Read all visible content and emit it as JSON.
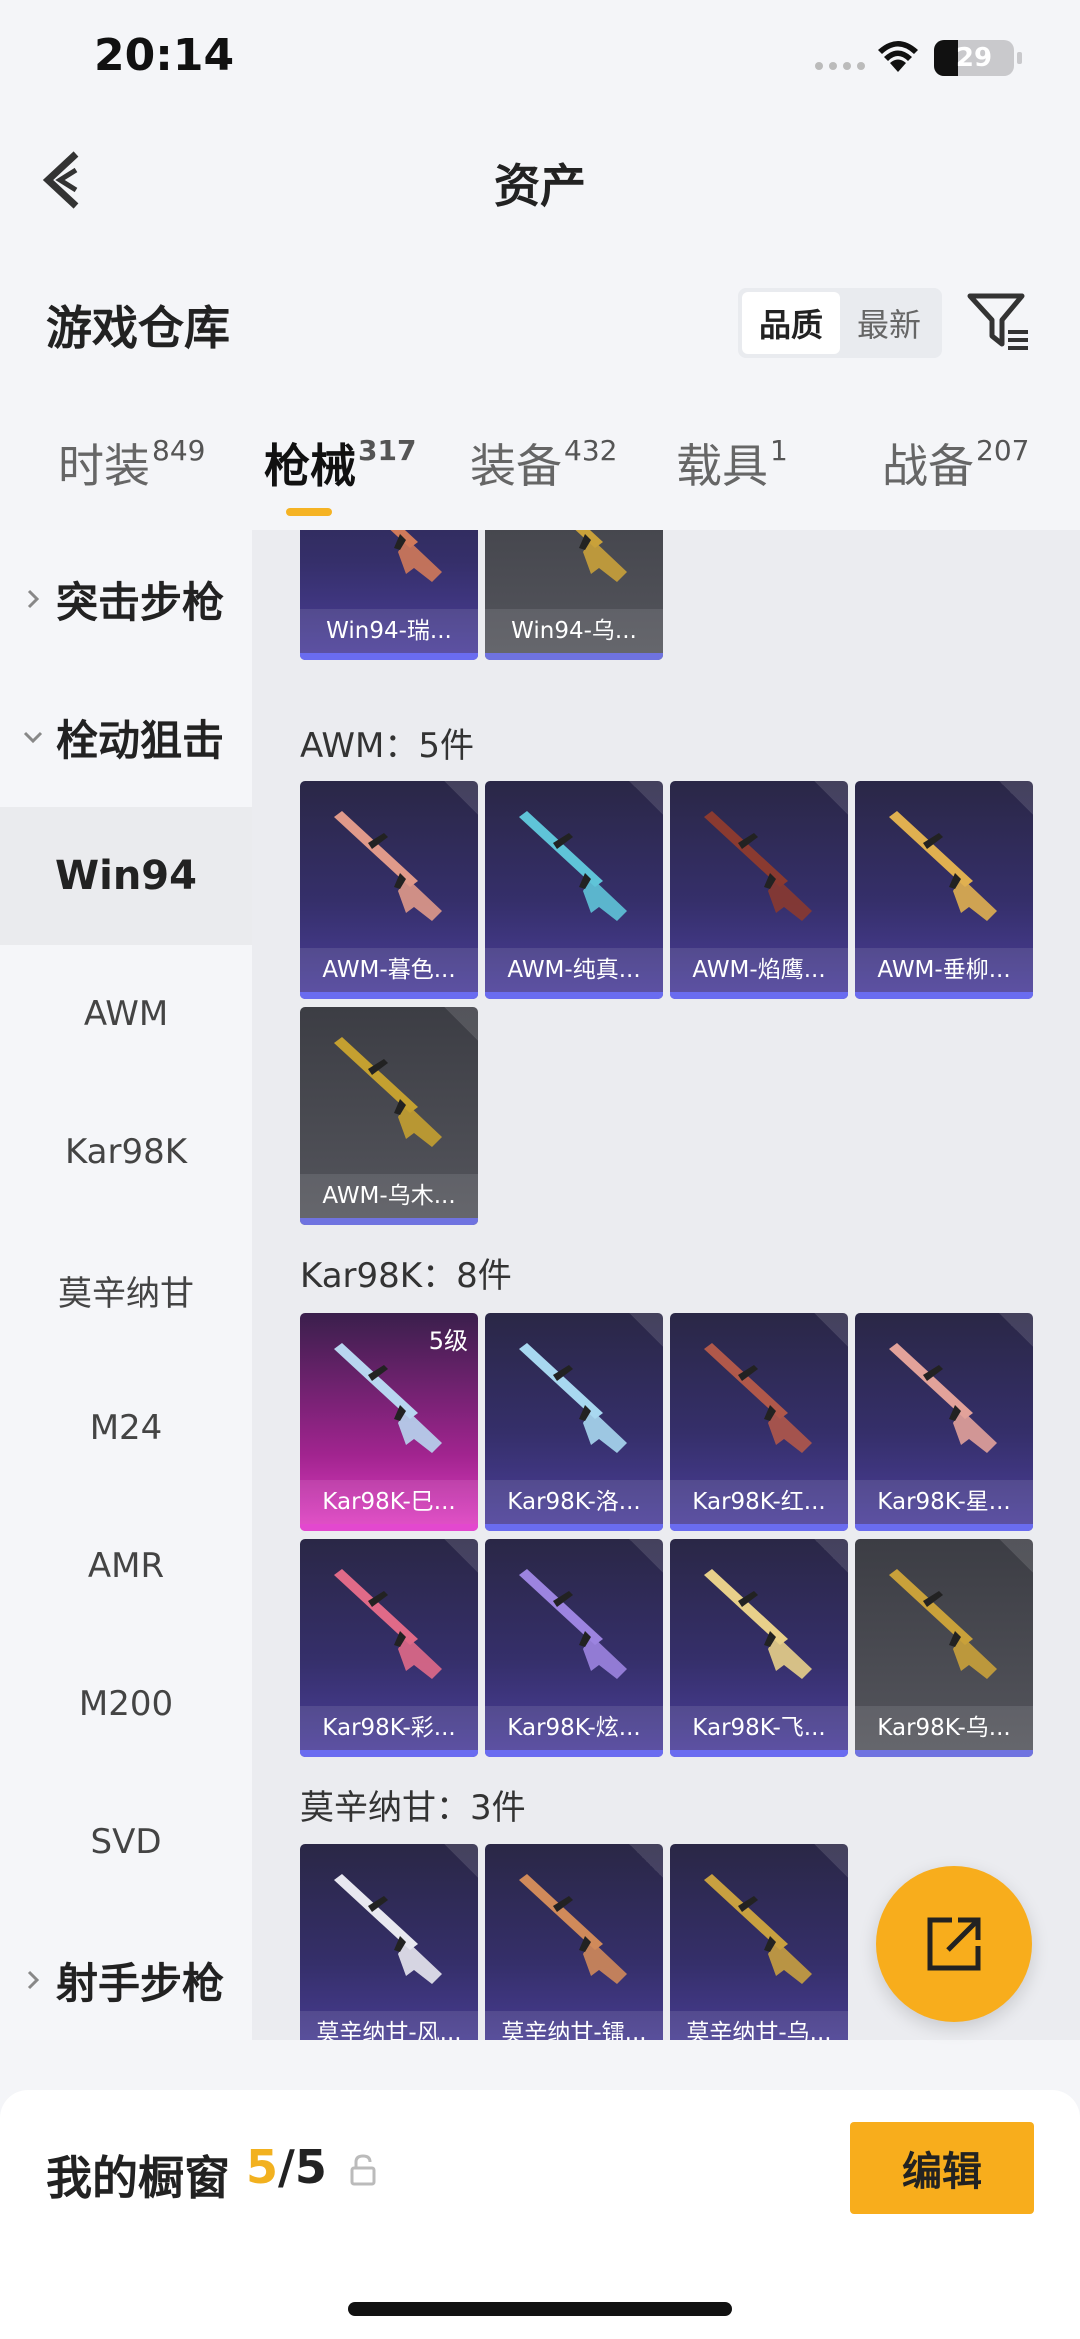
{
  "status": {
    "time": "20:14",
    "battery": "29"
  },
  "nav": {
    "title": "资产"
  },
  "section": {
    "title": "游戏仓库",
    "sort_options": [
      "品质",
      "最新"
    ]
  },
  "tabs": [
    {
      "label": "时装",
      "count": "849"
    },
    {
      "label": "枪械",
      "count": "317"
    },
    {
      "label": "装备",
      "count": "432"
    },
    {
      "label": "载具",
      "count": "1"
    },
    {
      "label": "战备",
      "count": "207"
    }
  ],
  "sidebar": {
    "group1": "突击步枪",
    "group2": "栓动狙击",
    "items": [
      "Win94",
      "AWM",
      "Kar98K",
      "莫辛纳甘",
      "M24",
      "AMR",
      "M200",
      "SVD"
    ],
    "group3": "射手步枪"
  },
  "content": {
    "win94": {
      "cards": [
        "Win94-瑞...",
        "Win94-乌..."
      ]
    },
    "awm": {
      "title": "AWM：5件",
      "cards": [
        "AWM-暮色...",
        "AWM-纯真...",
        "AWM-焰鹰...",
        "AWM-垂柳...",
        "AWM-乌木..."
      ]
    },
    "kar98k": {
      "title": "Kar98K：8件",
      "level_badge": "5级",
      "cards": [
        "Kar98K-巳...",
        "Kar98K-洛...",
        "Kar98K-红...",
        "Kar98K-星...",
        "Kar98K-彩...",
        "Kar98K-炫...",
        "Kar98K-飞...",
        "Kar98K-乌..."
      ]
    },
    "mosin": {
      "title": "莫辛纳甘：3件",
      "cards": [
        "莫辛纳甘-风...",
        "莫辛纳甘-镭...",
        "莫辛纳甘-乌..."
      ]
    }
  },
  "bottom": {
    "showcase_label": "我的橱窗",
    "showcase_current": "5",
    "showcase_total": "/5",
    "edit_label": "编辑"
  },
  "colors": {
    "accent": "#f8ad1c",
    "card_bar": "#6a6cf0",
    "card_pink": "#e348cf"
  }
}
